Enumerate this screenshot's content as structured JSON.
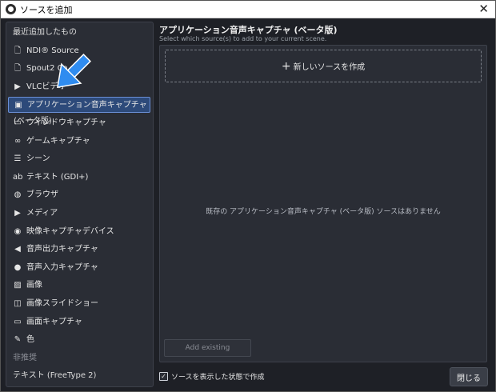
{
  "window": {
    "title": "ソースを追加",
    "close_glyph": "✕"
  },
  "sidebar": {
    "items": [
      {
        "label": "最近追加したもの",
        "kind": "section",
        "icon": ""
      },
      {
        "label": "NDI® Source",
        "icon": "file-icon"
      },
      {
        "label": "Spout2 Ca",
        "icon": "file-icon"
      },
      {
        "label": "VLCビデオ",
        "icon": "play-icon"
      },
      {
        "label": "アプリケーション音声キャプチャ (ベータ版)",
        "icon": "app-audio-icon",
        "selected": true
      },
      {
        "label": "ウィンドウキャプチャ",
        "icon": "window-icon"
      },
      {
        "label": "ゲームキャプチャ",
        "icon": "gamepad-icon"
      },
      {
        "label": "シーン",
        "icon": "list-icon"
      },
      {
        "label": "テキスト (GDI+)",
        "icon": "text-icon"
      },
      {
        "label": "ブラウザ",
        "icon": "globe-icon"
      },
      {
        "label": "メディア",
        "icon": "play-icon"
      },
      {
        "label": "映像キャプチャデバイス",
        "icon": "camera-icon"
      },
      {
        "label": "音声出力キャプチャ",
        "icon": "speaker-icon"
      },
      {
        "label": "音声入力キャプチャ",
        "icon": "microphone-icon"
      },
      {
        "label": "画像",
        "icon": "image-icon"
      },
      {
        "label": "画像スライドショー",
        "icon": "slideshow-icon"
      },
      {
        "label": "画面キャプチャ",
        "icon": "monitor-icon"
      },
      {
        "label": "色",
        "icon": "brush-icon"
      },
      {
        "label": "非推奨",
        "kind": "muted",
        "icon": ""
      },
      {
        "label": "テキスト (FreeType 2)",
        "kind": "section",
        "icon": ""
      }
    ]
  },
  "main": {
    "title": "アプリケーション音声キャプチャ (ベータ版)",
    "subtitle": "Select which source(s) to add to your current scene.",
    "create_new_label": "新しいソースを作成",
    "empty_message": "既存の アプリケーション音声キャプチャ (ベータ版) ソースはありません",
    "add_existing_label": "Add existing"
  },
  "footer": {
    "checkbox_label": "ソースを表示した状態で作成",
    "checkbox_checked": true,
    "close_label": "閉じる"
  },
  "colors": {
    "accent_arrow": "#2f8cf0",
    "selected_bg": "#2d4a7a",
    "selected_border": "#6a8fd6"
  }
}
